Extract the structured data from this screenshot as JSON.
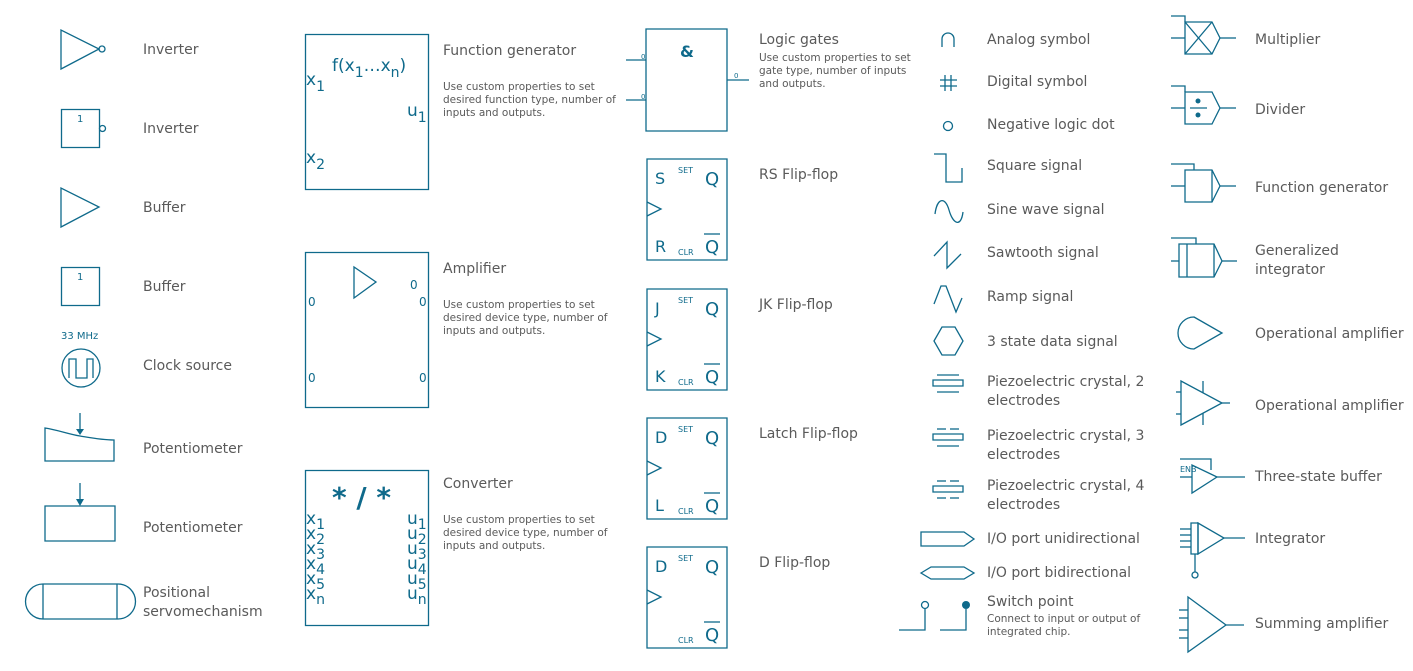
{
  "accent_color": "#0f6a8b",
  "text_color": "#5a5a5a",
  "column1": [
    {
      "label": "Inverter",
      "icon": "inverter-triangle-icon"
    },
    {
      "label": "Inverter",
      "icon": "inverter-box-icon",
      "box_text": "1"
    },
    {
      "label": "Buffer",
      "icon": "buffer-triangle-icon"
    },
    {
      "label": "Buffer",
      "icon": "buffer-box-icon",
      "box_text": "1"
    },
    {
      "label": "Clock source",
      "icon": "clock-source-icon",
      "freq": "33 MHz"
    },
    {
      "label": "Potentiometer",
      "icon": "potentiometer-curved-icon"
    },
    {
      "label": "Potentiometer",
      "icon": "potentiometer-rect-icon"
    },
    {
      "label": "Positional\nservomechanism",
      "line1": "Positional",
      "line2": "servomechanism",
      "icon": "servomechanism-icon"
    }
  ],
  "column2": {
    "function_generator": {
      "title": "Function generator",
      "desc": [
        "Use custom properties to set",
        "desired function type, number of",
        "inputs and outputs."
      ],
      "formula": "f(x",
      "formula_sub1": "1",
      "formula_mid": "…x",
      "formula_subn": "n",
      "formula_end": ")",
      "inputs": [
        {
          "v": "x",
          "s": "1"
        },
        {
          "v": "x",
          "s": "2"
        }
      ],
      "outputs": [
        {
          "v": "u",
          "s": "1"
        }
      ]
    },
    "amplifier": {
      "title": "Amplifier",
      "desc": [
        "Use custom properties to set",
        "desired device type, number of",
        "inputs and outputs."
      ],
      "values": {
        "top_out": "0",
        "in1": "0",
        "out1": "0",
        "in2": "0",
        "out2": "0"
      }
    },
    "converter": {
      "title": "Converter",
      "desc": [
        "Use custom properties to set",
        "desired device type, number of",
        "inputs and outputs."
      ],
      "symbol": "* / *",
      "inputs": [
        {
          "v": "x",
          "s": "1"
        },
        {
          "v": "x",
          "s": "2"
        },
        {
          "v": "x",
          "s": "3"
        },
        {
          "v": "x",
          "s": "4"
        },
        {
          "v": "x",
          "s": "5"
        },
        {
          "v": "x",
          "s": "n"
        }
      ],
      "outputs": [
        {
          "v": "u",
          "s": "1"
        },
        {
          "v": "u",
          "s": "2"
        },
        {
          "v": "u",
          "s": "3"
        },
        {
          "v": "u",
          "s": "4"
        },
        {
          "v": "u",
          "s": "5"
        },
        {
          "v": "u",
          "s": "n"
        }
      ]
    }
  },
  "column3": {
    "logic_gates": {
      "title": "Logic gates",
      "desc": [
        "Use custom properties to set",
        "gate type, number of inputs",
        "and outputs."
      ],
      "symbol": "&",
      "in1": "0",
      "in2": "0",
      "out": "0"
    },
    "flipflops": [
      {
        "title": "RS Flip-flop",
        "top_in": "S",
        "bottom_in": "R",
        "set": "SET",
        "clr": "CLR",
        "q": "Q",
        "qbar": "Q"
      },
      {
        "title": "JK Flip-flop",
        "top_in": "J",
        "bottom_in": "K",
        "set": "SET",
        "clr": "CLR",
        "q": "Q",
        "qbar": "Q"
      },
      {
        "title": "Latch Flip-flop",
        "top_in": "D",
        "bottom_in": "L",
        "set": "SET",
        "clr": "CLR",
        "q": "Q",
        "qbar": "Q"
      },
      {
        "title": "D Flip-flop",
        "top_in": "D",
        "bottom_in": "",
        "set": "SET",
        "clr": "CLR",
        "q": "Q",
        "qbar": "Q"
      }
    ]
  },
  "column4": [
    {
      "label": "Analog symbol",
      "icon": "analog-symbol-icon"
    },
    {
      "label": "Digital symbol",
      "icon": "digital-symbol-icon"
    },
    {
      "label": "Negative logic dot",
      "icon": "negative-logic-dot-icon"
    },
    {
      "label": "Square signal",
      "icon": "square-signal-icon"
    },
    {
      "label": "Sine wave signal",
      "icon": "sine-wave-icon"
    },
    {
      "label": "Sawtooth signal",
      "icon": "sawtooth-signal-icon"
    },
    {
      "label": "Ramp signal",
      "icon": "ramp-signal-icon"
    },
    {
      "label": "3 state data signal",
      "icon": "three-state-data-icon"
    },
    {
      "line1": "Piezoelectric crystal, 2",
      "line2": "electrodes",
      "icon": "piezo-2-icon"
    },
    {
      "line1": "Piezoelectric crystal, 3",
      "line2": "electrodes",
      "icon": "piezo-3-icon"
    },
    {
      "line1": "Piezoelectric crystal, 4",
      "line2": "electrodes",
      "icon": "piezo-4-icon"
    },
    {
      "label": "I/O port unidirectional",
      "icon": "io-port-unidirectional-icon"
    },
    {
      "label": "I/O port bidirectional",
      "icon": "io-port-bidirectional-icon"
    },
    {
      "label": "Switch point",
      "desc": [
        "Connect to input or output of",
        "integrated chip."
      ],
      "icon": "switch-point-icon"
    }
  ],
  "column5": [
    {
      "label": "Multiplier",
      "icon": "multiplier-icon"
    },
    {
      "label": "Divider",
      "icon": "divider-icon"
    },
    {
      "label": "Function generator",
      "icon": "function-generator-small-icon"
    },
    {
      "line1": "Generalized",
      "line2": "integrator",
      "icon": "generalized-integrator-icon"
    },
    {
      "label": "Operational amplifier",
      "icon": "op-amp-curved-icon"
    },
    {
      "label": "Operational amplifier",
      "icon": "op-amp-triangle-icon"
    },
    {
      "label": "Three-state buffer",
      "icon": "three-state-buffer-icon",
      "enb": "ENB"
    },
    {
      "label": "Integrator",
      "icon": "integrator-icon"
    },
    {
      "label": "Summing amplifier",
      "icon": "summing-amplifier-icon"
    }
  ]
}
